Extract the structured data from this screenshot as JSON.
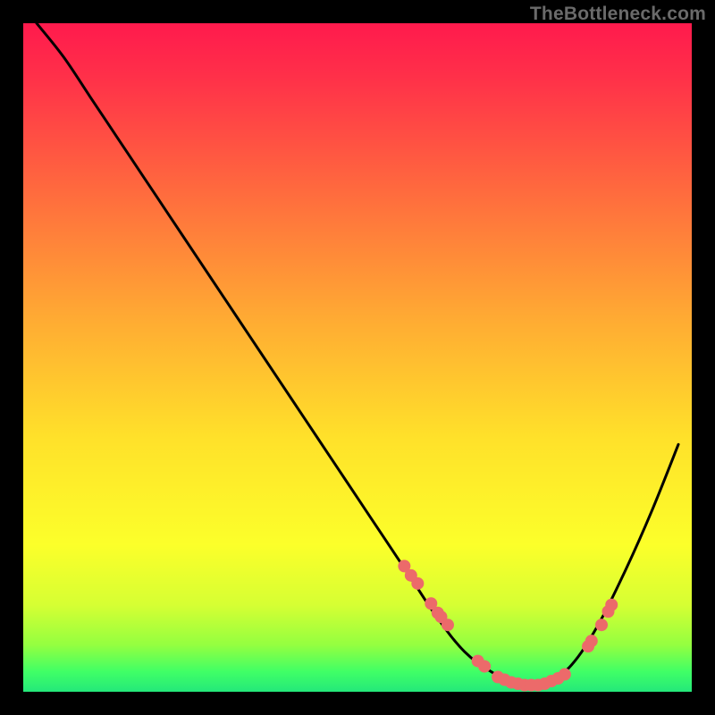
{
  "watermark": "TheBottleneck.com",
  "chart_data": {
    "type": "line",
    "title": "",
    "xlabel": "",
    "ylabel": "",
    "xlim": [
      0,
      100
    ],
    "ylim": [
      0,
      100
    ],
    "grid": false,
    "legend": false,
    "curve": {
      "name": "bottleneck-curve",
      "color": "#000000",
      "x": [
        2,
        6,
        10,
        14,
        18,
        22,
        26,
        30,
        34,
        38,
        42,
        46,
        50,
        54,
        58,
        62,
        66,
        70,
        74,
        78,
        82,
        86,
        90,
        94,
        98
      ],
      "y": [
        100,
        95,
        89,
        83,
        77,
        71,
        65,
        59,
        53,
        47,
        41,
        35,
        29,
        23,
        17,
        11,
        6,
        3,
        1,
        1,
        4,
        10,
        18,
        27,
        37
      ]
    },
    "markers": {
      "name": "data-points",
      "color": "#ec6a6a",
      "x": [
        57,
        58,
        59,
        61,
        62,
        62.5,
        63.5,
        68,
        69,
        71,
        72,
        73,
        74,
        75,
        76,
        77,
        78,
        79,
        80,
        81,
        84.5,
        85,
        86.5,
        87.5,
        88
      ],
      "y": [
        18.8,
        17.4,
        16.2,
        13.2,
        11.8,
        11.2,
        10.0,
        4.6,
        3.8,
        2.2,
        1.8,
        1.4,
        1.2,
        1.0,
        1.0,
        1.0,
        1.2,
        1.6,
        2.0,
        2.6,
        6.8,
        7.6,
        10.0,
        12.0,
        13.0
      ]
    }
  }
}
